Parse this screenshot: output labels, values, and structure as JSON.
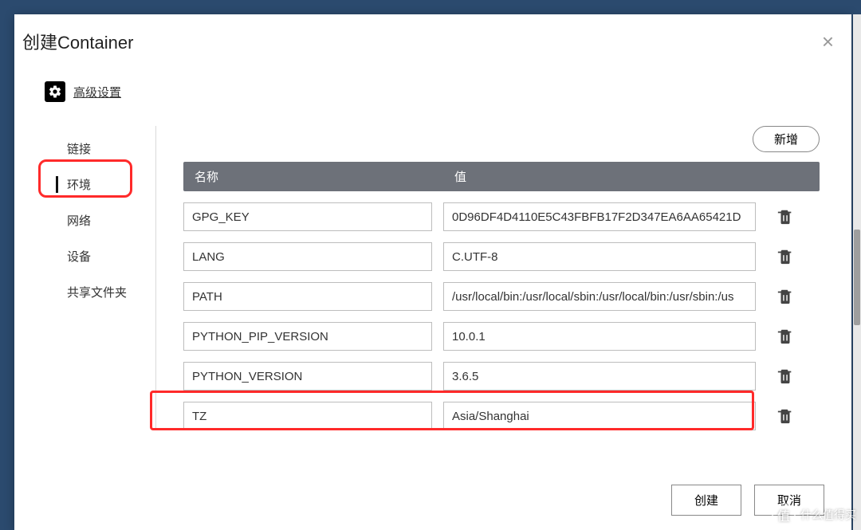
{
  "dialog": {
    "title": "创建Container",
    "advanced_label": "高级设置",
    "tabs": [
      "链接",
      "环境",
      "网络",
      "设备",
      "共享文件夹"
    ],
    "active_tab_index": 1,
    "add_button": "新增",
    "col_name": "名称",
    "col_value": "值",
    "env": [
      {
        "name": "GPG_KEY",
        "value": "0D96DF4D4110E5C43FBFB17F2D347EA6AA65421D"
      },
      {
        "name": "LANG",
        "value": "C.UTF-8"
      },
      {
        "name": "PATH",
        "value": "/usr/local/bin:/usr/local/sbin:/usr/local/bin:/usr/sbin:/us"
      },
      {
        "name": "PYTHON_PIP_VERSION",
        "value": "10.0.1"
      },
      {
        "name": "PYTHON_VERSION",
        "value": "3.6.5"
      },
      {
        "name": "TZ",
        "value": "Asia/Shanghai"
      }
    ],
    "highlight_row_index": 5,
    "create_button": "创建",
    "cancel_button": "取消"
  },
  "watermark": "什么值得买"
}
